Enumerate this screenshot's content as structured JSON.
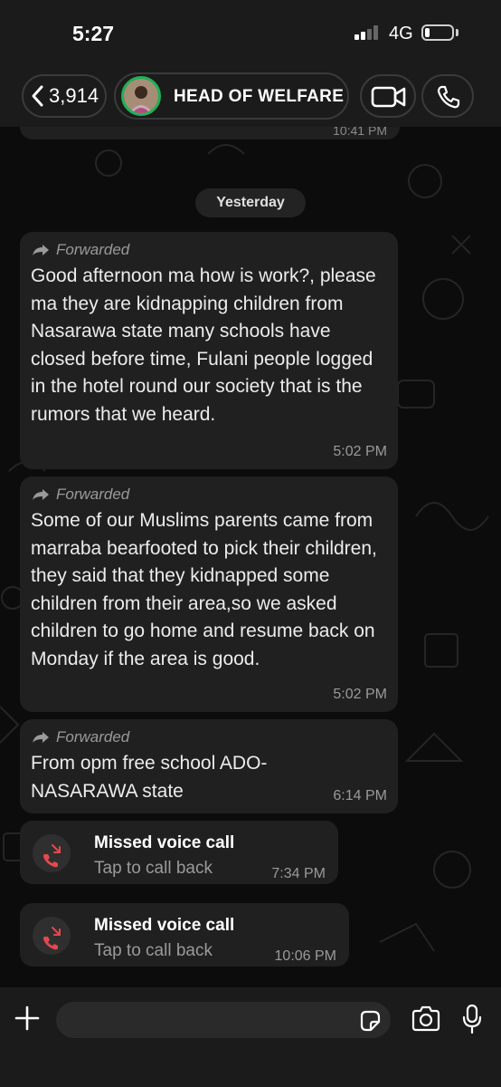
{
  "status_bar": {
    "time": "5:27",
    "network": "4G"
  },
  "header": {
    "back_count": "3,914",
    "contact_name": "HEAD OF WELFARE"
  },
  "prev_message": {
    "time": "10:41 PM"
  },
  "date_separator": "Yesterday",
  "messages": [
    {
      "forwarded_label": "Forwarded",
      "text": "Good afternoon ma how is work?, please ma they are kidnapping children from Nasarawa state many schools have closed before time, Fulani people logged in the hotel round our society that is the rumors that we heard.",
      "time": "5:02 PM"
    },
    {
      "forwarded_label": "Forwarded",
      "text": "Some of our Muslims parents came from marraba bearfooted to pick their children, they said that they kidnapped some children from their area,so we asked children to go home and resume back on Monday if the area is good.",
      "time": "5:02 PM"
    },
    {
      "forwarded_label": "Forwarded",
      "text": "From opm free school ADO-NASARAWA state",
      "time": "6:14 PM"
    }
  ],
  "calls": [
    {
      "title": "Missed voice call",
      "subtitle": "Tap to call back",
      "time": "7:34 PM"
    },
    {
      "title": "Missed voice call",
      "subtitle": "Tap to call back",
      "time": "10:06 PM"
    }
  ],
  "colors": {
    "background": "#0b0b0b",
    "bubble": "#202020",
    "accent_green": "#1fb256",
    "missed_call_red": "#e5484d"
  },
  "icons": [
    "back-chevron-icon",
    "video-call-icon",
    "phone-icon",
    "forward-arrow-icon",
    "missed-call-icon",
    "plus-icon",
    "sticker-icon",
    "camera-icon",
    "microphone-icon"
  ]
}
